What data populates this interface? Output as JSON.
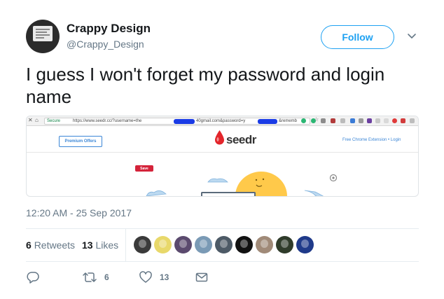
{
  "author": {
    "name": "Crappy Design",
    "handle": "@Crappy_Design",
    "follow_label": "Follow"
  },
  "tweet": {
    "text": "I guess I won't forget my password and login name",
    "timestamp": "12:20 AM - 25 Sep 2017"
  },
  "screenshot": {
    "secure_label": "Secure",
    "url_prefix": "https://www.seedr.cc/?username=the",
    "url_middle": "40gmail.com&password=y",
    "url_suffix": "&rememb",
    "premium_label": "Premium Offers",
    "brand": "seedr",
    "links_text": "Free Chrome Extension • Login",
    "save_label": "Save"
  },
  "stats": {
    "retweets_count": "6",
    "retweets_label": "Retweets",
    "likes_count": "13",
    "likes_label": "Likes",
    "liker_avatar_colors": [
      "#3a3a3a",
      "#e8d86a",
      "#5b4a6e",
      "#7a9ab5",
      "#4d5a66",
      "#111111",
      "#a08a78",
      "#2f3b2a",
      "#1f3a8a"
    ]
  },
  "actions": {
    "reply_icon": "reply-icon",
    "retweet_icon": "retweet-icon",
    "retweet_count": "6",
    "like_icon": "heart-icon",
    "like_count": "13",
    "message_icon": "envelope-icon"
  },
  "colors": {
    "accent": "#1da1f2",
    "secondary_text": "#657786",
    "redaction": "#1a3be6",
    "seedr_red": "#e3252b"
  }
}
